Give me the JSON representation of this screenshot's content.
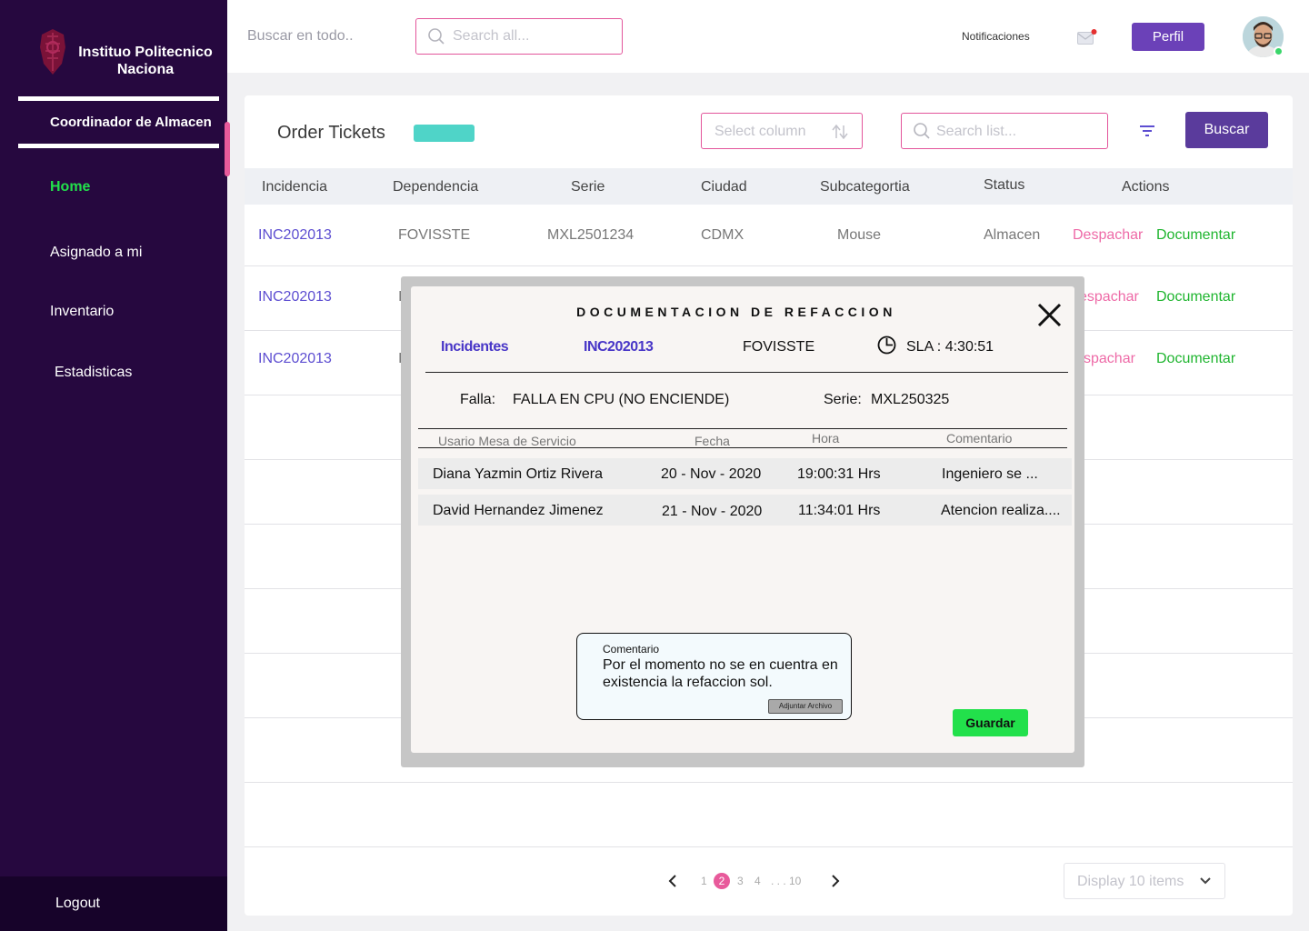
{
  "sidebar": {
    "brand": "Instituo Politecnico Naciona",
    "role": "Coordinador de Almacen",
    "items": [
      "Home",
      "Asignado a mi",
      "Inventario",
      "Estadisticas"
    ],
    "logout": "Logout"
  },
  "topbar": {
    "search_hint": "Buscar en todo..",
    "search_placeholder": "Search all...",
    "notifications": "Notificaciones",
    "profile_button": "Perfil"
  },
  "main": {
    "title": "Order Tickets",
    "select_column_placeholder": "Select column",
    "search_list_placeholder": "Search list...",
    "search_button": "Buscar",
    "columns": [
      "Incidencia",
      "Dependencia",
      "Serie",
      "Ciudad",
      "Subcategortia",
      "Status",
      "Actions"
    ],
    "rows": [
      {
        "incidencia": "INC202013",
        "dependencia": "FOVISSTE",
        "serie": "MXL2501234",
        "ciudad": "CDMX",
        "subcategoria": "Mouse",
        "status": "Almacen",
        "action1": "Despachar",
        "action2": "Documentar"
      },
      {
        "incidencia": "INC202013",
        "dependencia": "I",
        "action1": "espachar",
        "action2": "Documentar"
      },
      {
        "incidencia": "INC202013",
        "dependencia": "I",
        "action1": "spachar",
        "action2": "Documentar"
      }
    ]
  },
  "pagination": {
    "pages": [
      "1",
      "2",
      "3",
      "4",
      ". . . 10"
    ],
    "active_page": "2",
    "display": "Display 10 items"
  },
  "modal": {
    "title": "DOCUMENTACION DE REFACCION",
    "section": "Incidentes",
    "incident": "INC202013",
    "dependency": "FOVISSTE",
    "sla": "SLA :  4:30:51",
    "falla_label": "Falla:",
    "falla_value": "FALLA EN CPU (NO ENCIENDE)",
    "serie_label": "Serie:",
    "serie_value": "MXL250325",
    "columns": [
      "Usario Mesa de Servicio",
      "Fecha",
      "Hora",
      "Comentario"
    ],
    "rows": [
      {
        "user": "Diana Yazmin Ortiz Rivera",
        "date": "20 - Nov - 2020",
        "time": "19:00:31 Hrs",
        "comment": "Ingeniero se ..."
      },
      {
        "user": "David Hernandez Jimenez",
        "date": "21 - Nov - 2020",
        "time": "11:34:01 Hrs",
        "comment": "Atencion realiza...."
      }
    ],
    "comment_label": "Comentario",
    "comment_text": "Por el momento no se en cuentra en existencia la refaccion sol.",
    "attach_button": "Adjuntar Archivo",
    "save_button": "Guardar"
  },
  "colors": {
    "sidebar": "#26083f",
    "accent_purple": "#6b41b8",
    "accent_pink": "#e85a9b",
    "accent_green": "#22e04b",
    "link_blue": "#5d4ed1",
    "teal": "#4fd4c8"
  }
}
